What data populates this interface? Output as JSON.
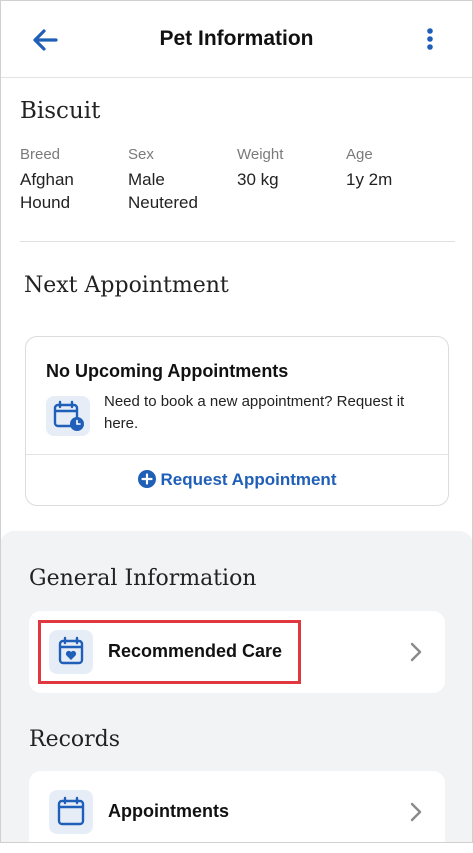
{
  "header": {
    "title": "Pet Information",
    "back_icon": "arrow-left-icon",
    "more_icon": "vertical-dots-icon",
    "accent": "#1f5fb8"
  },
  "pet": {
    "name": "Biscuit",
    "attributes": [
      {
        "label": "Breed",
        "value_line1": "Afghan",
        "value_line2": "Hound"
      },
      {
        "label": "Sex",
        "value_line1": "Male",
        "value_line2": "Neutered"
      },
      {
        "label": "Weight",
        "value_line1": "30 kg",
        "value_line2": ""
      },
      {
        "label": "Age",
        "value_line1": "1y 2m",
        "value_line2": ""
      }
    ]
  },
  "next_appointment": {
    "section_title": "Next Appointment",
    "card_heading": "No Upcoming Appointments",
    "card_text": "Need to book a new appointment? Request it here.",
    "icon": "calendar-clock-icon",
    "request_button": "Request Appointment",
    "request_icon": "plus-circle-icon"
  },
  "general_information": {
    "section_title": "General Information",
    "items": [
      {
        "label": "Recommended Care",
        "icon": "calendar-heart-icon"
      }
    ]
  },
  "records": {
    "section_title": "Records",
    "items": [
      {
        "label": "Appointments",
        "icon": "calendar-icon"
      }
    ]
  },
  "colors": {
    "highlight_box": "#e0383e",
    "icon_tile": "#e7edf7",
    "grey_background": "#f2f3f5"
  }
}
